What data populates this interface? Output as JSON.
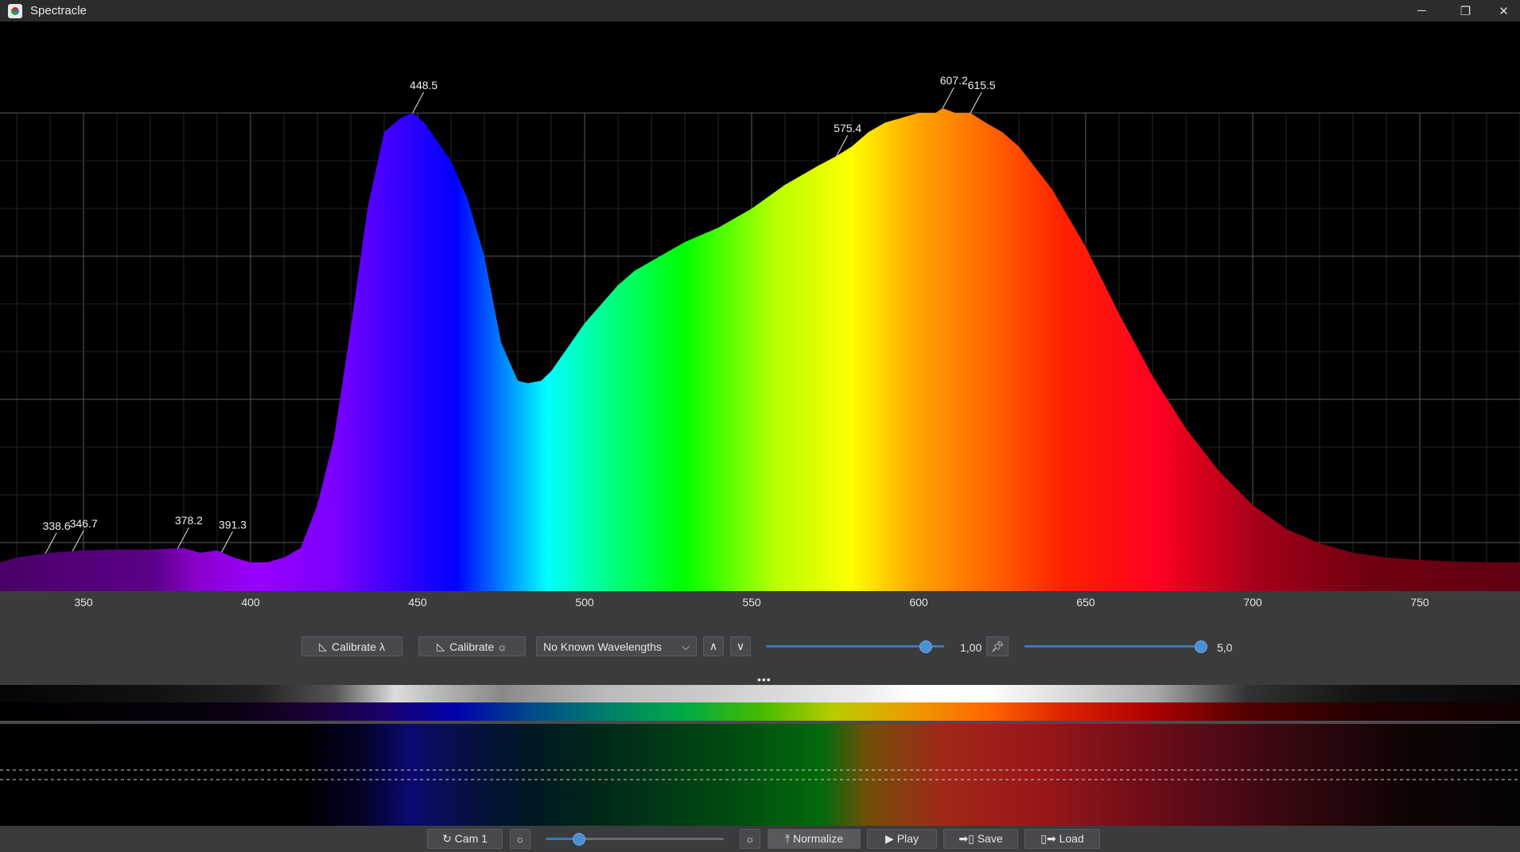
{
  "window": {
    "title": "Spectracle",
    "minimize_glyph": "─",
    "maximize_glyph": "❐",
    "close_glyph": "✕"
  },
  "chart_data": {
    "type": "area",
    "xlim": [
      325,
      780
    ],
    "x_ticks": [
      350,
      400,
      450,
      500,
      550,
      600,
      650,
      700,
      750
    ],
    "tick_labels": [
      "350",
      "400",
      "450",
      "500",
      "550",
      "600",
      "650",
      "700",
      "750"
    ],
    "x": [
      325,
      330,
      340,
      350,
      360,
      370,
      380,
      385,
      390,
      395,
      400,
      405,
      410,
      415,
      420,
      425,
      430,
      435,
      440,
      445,
      448.5,
      452,
      456,
      460,
      465,
      470,
      475,
      480,
      483,
      487,
      490,
      495,
      500,
      505,
      510,
      515,
      520,
      530,
      540,
      550,
      560,
      570,
      575.4,
      580,
      585,
      590,
      595,
      600,
      605,
      607.2,
      611,
      615.5,
      620,
      625,
      630,
      640,
      650,
      660,
      670,
      680,
      690,
      700,
      710,
      720,
      730,
      740,
      750,
      760,
      770,
      780
    ],
    "y": [
      0.06,
      0.07,
      0.08,
      0.085,
      0.087,
      0.087,
      0.09,
      0.08,
      0.085,
      0.07,
      0.06,
      0.06,
      0.07,
      0.09,
      0.18,
      0.32,
      0.55,
      0.8,
      0.96,
      0.99,
      1.0,
      0.98,
      0.94,
      0.9,
      0.82,
      0.7,
      0.52,
      0.44,
      0.435,
      0.44,
      0.46,
      0.51,
      0.56,
      0.6,
      0.64,
      0.67,
      0.69,
      0.73,
      0.76,
      0.8,
      0.85,
      0.89,
      0.91,
      0.93,
      0.96,
      0.98,
      0.99,
      1.0,
      1.0,
      1.01,
      1.0,
      1.0,
      0.98,
      0.96,
      0.93,
      0.84,
      0.72,
      0.58,
      0.45,
      0.34,
      0.25,
      0.18,
      0.13,
      0.1,
      0.08,
      0.07,
      0.065,
      0.062,
      0.06,
      0.06
    ],
    "peaks": [
      {
        "label": "338.6",
        "x": 338.6
      },
      {
        "label": "346.7",
        "x": 346.7
      },
      {
        "label": "378.2",
        "x": 378.2
      },
      {
        "label": "391.3",
        "x": 391.3
      },
      {
        "label": "448.5",
        "x": 448.5
      },
      {
        "label": "575.4",
        "x": 575.4
      },
      {
        "label": "607.2",
        "x": 607.2
      },
      {
        "label": "615.5",
        "x": 615.5
      }
    ],
    "grid": true
  },
  "controls": {
    "calibrate_wavelength_label": "Calibrate λ",
    "calibrate_brightness_label": "Calibrate ☼",
    "known_wavelengths_value": "No Known Wavelengths",
    "up_glyph": "∧",
    "down_glyph": "∨",
    "slider1_value": "1,00",
    "slider1_level": 0.9,
    "slider2_value": "5,0",
    "slider2_level": 1.0,
    "more_dots": "•••"
  },
  "bottom_toolbar": {
    "cam_label": "↻ Cam 1",
    "brightness_icon": "☼",
    "exposure_level": 0.16,
    "brightness2_icon": "☼",
    "normalize_label": "⤒ Normalize",
    "play_label": "▶ Play",
    "save_label": "➡▯ Save",
    "load_label": "▯➡ Load"
  },
  "colors": {
    "background": "#000000",
    "panel": "#3a3b3d",
    "accent": "#4a8fd3"
  }
}
